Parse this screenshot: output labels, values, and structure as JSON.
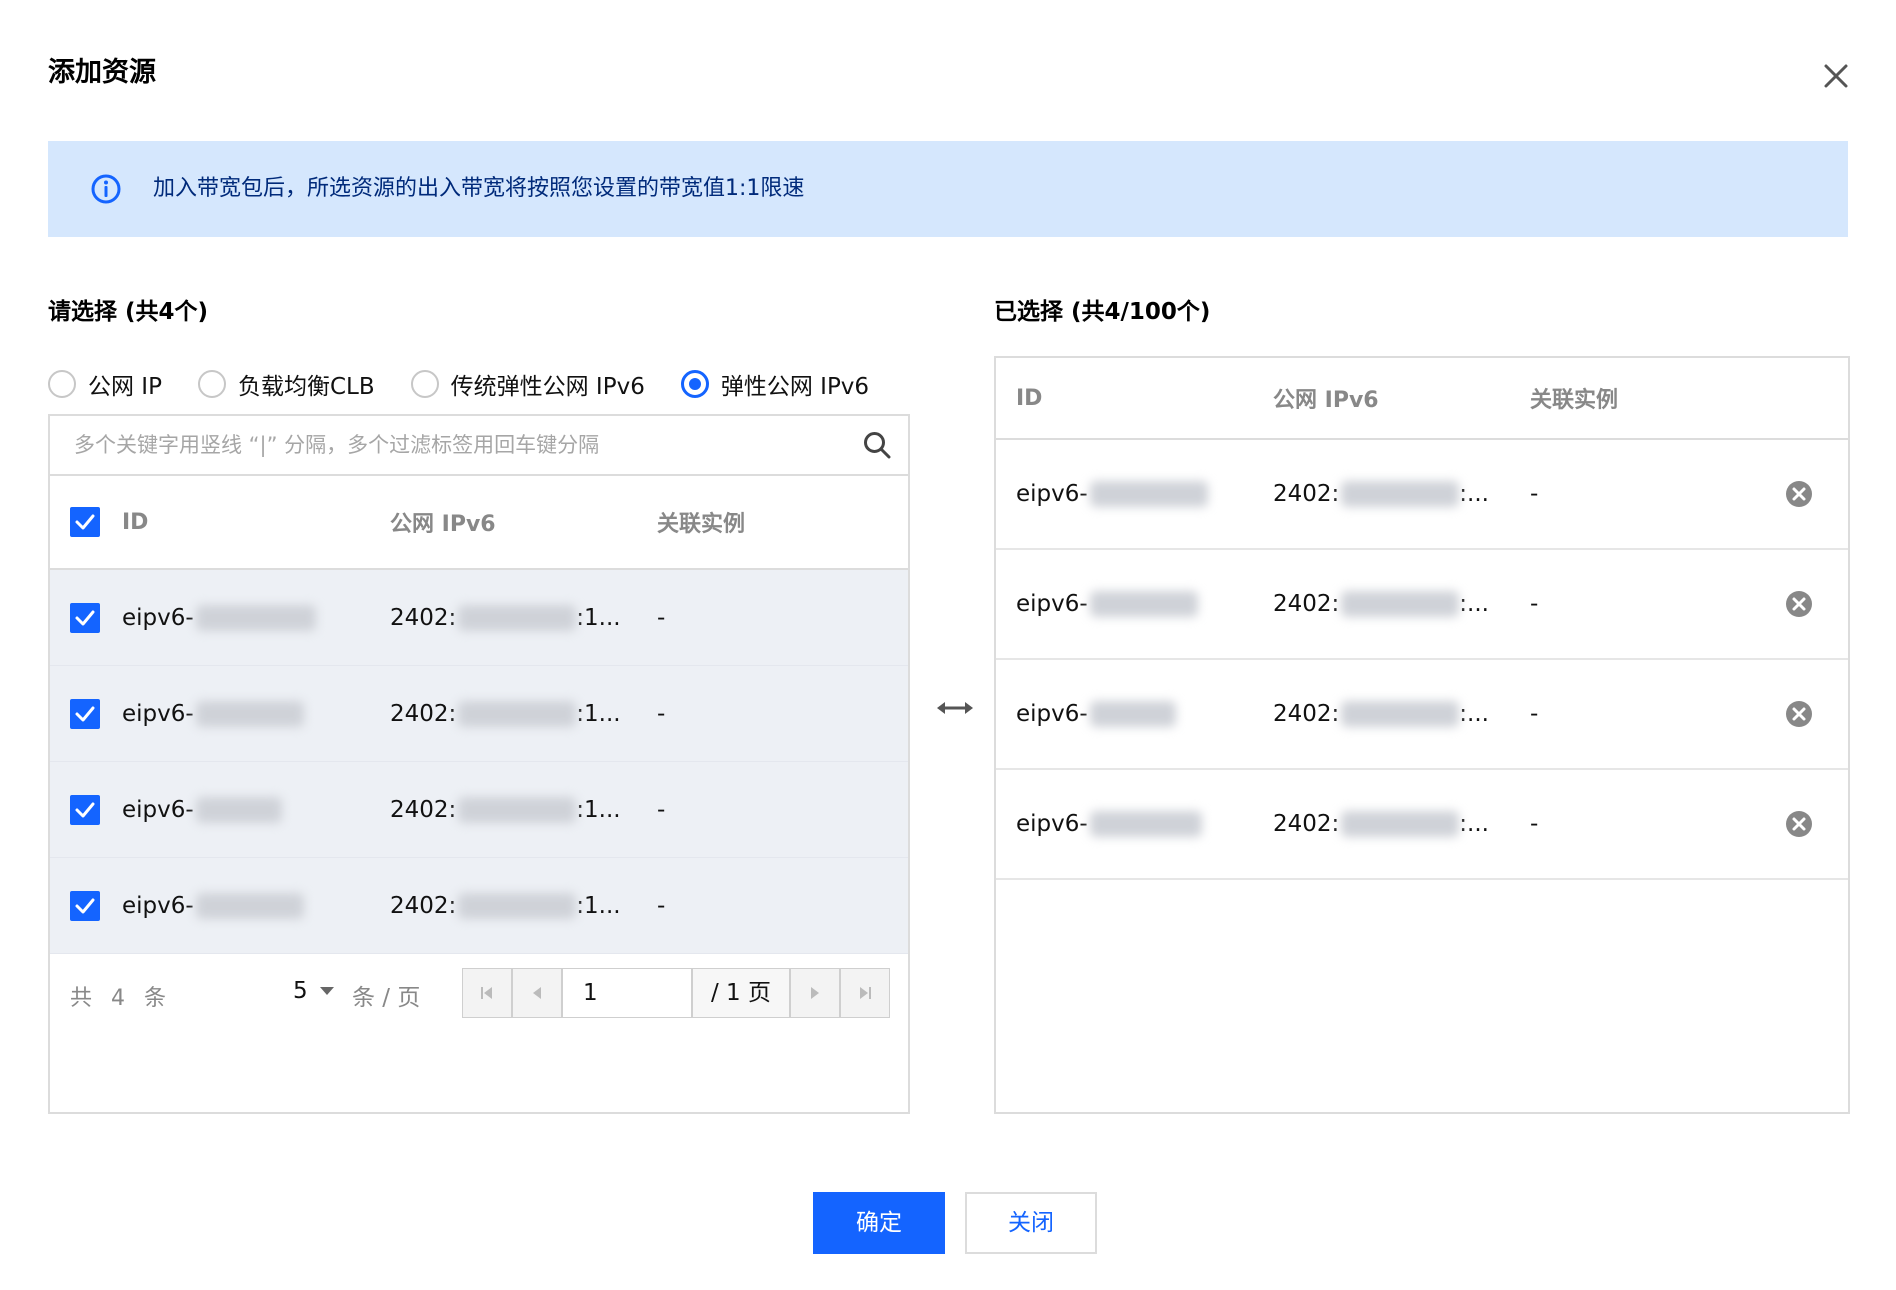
{
  "dialog": {
    "title": "添加资源",
    "notice": "加入带宽包后，所选资源的出入带宽将按照您设置的带宽值1:1限速"
  },
  "left": {
    "title": "请选择 (共4个)",
    "radios": [
      {
        "label": "公网 IP",
        "checked": false
      },
      {
        "label": "负载均衡CLB",
        "checked": false
      },
      {
        "label": "传统弹性公网 IPv6",
        "checked": false
      },
      {
        "label": "弹性公网 IPv6",
        "checked": true
      }
    ],
    "search_placeholder": "多个关键字用竖线 “|” 分隔，多个过滤标签用回车键分隔",
    "columns": {
      "id": "ID",
      "ip": "公网 IPv6",
      "instance": "关联实例"
    },
    "rows": [
      {
        "id": "eipv6-",
        "ip": "2402:",
        "ip_suffix": ":1...",
        "instance": "-",
        "checked": true
      },
      {
        "id": "eipv6-",
        "ip": "2402:",
        "ip_suffix": ":1...",
        "instance": "-",
        "checked": true
      },
      {
        "id": "eipv6-",
        "ip": "2402:",
        "ip_suffix": ":1...",
        "instance": "-",
        "checked": true
      },
      {
        "id": "eipv6-",
        "ip": "2402:",
        "ip_suffix": ":1...",
        "instance": "-",
        "checked": true
      }
    ],
    "pagination": {
      "total": "共 4 条",
      "page_size": "5",
      "page_size_unit": "条 / 页",
      "current_page": "1",
      "page_of": "/ 1 页"
    }
  },
  "right": {
    "title": "已选择 (共4/100个)",
    "columns": {
      "id": "ID",
      "ip": "公网 IPv6",
      "instance": "关联实例"
    },
    "rows": [
      {
        "id": "eipv6-",
        "ip": "2402:",
        "ip_suffix": ":...",
        "instance": "-"
      },
      {
        "id": "eipv6-",
        "ip": "2402:",
        "ip_suffix": ":...",
        "instance": "-"
      },
      {
        "id": "eipv6-",
        "ip": "2402:",
        "ip_suffix": ":...",
        "instance": "-"
      },
      {
        "id": "eipv6-",
        "ip": "2402:",
        "ip_suffix": ":...",
        "instance": "-"
      }
    ]
  },
  "footer": {
    "confirm": "确定",
    "close": "关闭"
  },
  "colors": {
    "accent": "#1464ff",
    "notice_bg": "#d5e7fd",
    "row_selected_bg": "#edf0f5"
  },
  "icons": [
    "close-icon",
    "info-icon",
    "search-icon",
    "check-icon",
    "first-page-icon",
    "prev-page-icon",
    "next-page-icon",
    "last-page-icon",
    "swap-icon",
    "remove-icon"
  ]
}
